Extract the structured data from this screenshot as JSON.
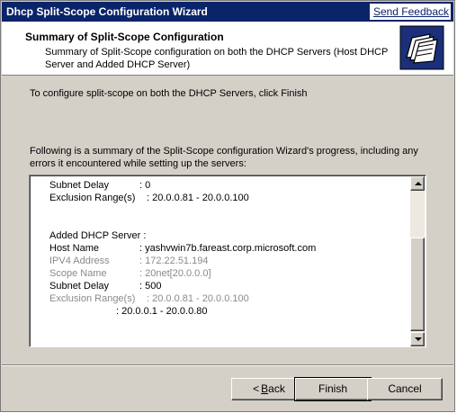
{
  "window": {
    "title": "Dhcp Split-Scope Configuration Wizard",
    "feedback_link": "Send Feedback"
  },
  "header": {
    "title": "Summary of Split-Scope Configuration",
    "subtitle": "Summary of Split-Scope configuration on both the DHCP Servers (Host DHCP Server and Added DHCP Server)",
    "icon": "folders-icon"
  },
  "body": {
    "instruction": "To configure split-scope on both the DHCP Servers, click Finish",
    "summary_intro": "Following is a summary of the Split-Scope configuration Wizard's progress, including any errors it encountered while setting up the servers:"
  },
  "summary": {
    "top_rows": [
      {
        "label": "Subnet Delay",
        "value": ": 0"
      },
      {
        "label": "Exclusion Range(s)",
        "value": ": 20.0.0.81 - 20.0.0.100"
      }
    ],
    "added_server_heading": "Added DHCP Server :",
    "added_rows": [
      {
        "label": "Host Name",
        "value": ": yashvwin7b.fareast.corp.microsoft.com"
      },
      {
        "label": "IPV4 Address",
        "value": ": 172.22.51.194"
      },
      {
        "label": "Scope Name",
        "value": ": 20net[20.0.0.0]"
      },
      {
        "label": "Subnet Delay",
        "value": ": 500"
      },
      {
        "label": "Exclusion Range(s)",
        "value": ": 20.0.0.81 - 20.0.0.100"
      }
    ],
    "continuation": ": 20.0.0.1 - 20.0.0.80"
  },
  "buttons": {
    "back_arrow": "<",
    "back_accel": "B",
    "back_rest": "ack",
    "finish": "Finish",
    "cancel": "Cancel"
  },
  "colors": {
    "titlebar": "#0a246a",
    "dialog_face": "#d4d0c8",
    "dim_text": "#8a8a8a"
  }
}
